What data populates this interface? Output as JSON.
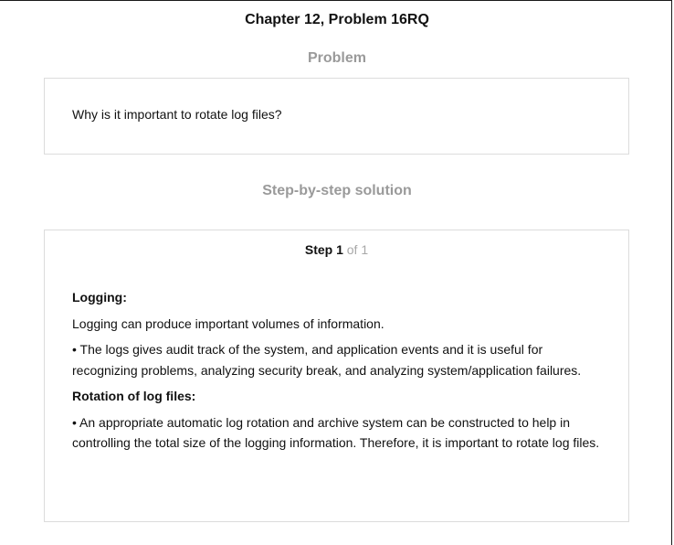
{
  "header": {
    "chapter_title": "Chapter 12, Problem 16RQ"
  },
  "problem": {
    "heading": "Problem",
    "text": "Why is it important to rotate log files?"
  },
  "solution": {
    "heading": "Step-by-step solution",
    "step_label": "Step 1",
    "step_of": " of 1",
    "logging_heading": "Logging:",
    "logging_para1": "Logging can produce important volumes of information.",
    "logging_para2": "• The logs gives audit track of the system, and application events and it is useful for recognizing problems, analyzing security break, and analyzing system/application failures.",
    "rotation_heading": "Rotation of log files:",
    "rotation_para1": "• An appropriate automatic log rotation and archive system can be constructed to help in controlling the total size of the logging information. Therefore, it is important to rotate log files."
  }
}
